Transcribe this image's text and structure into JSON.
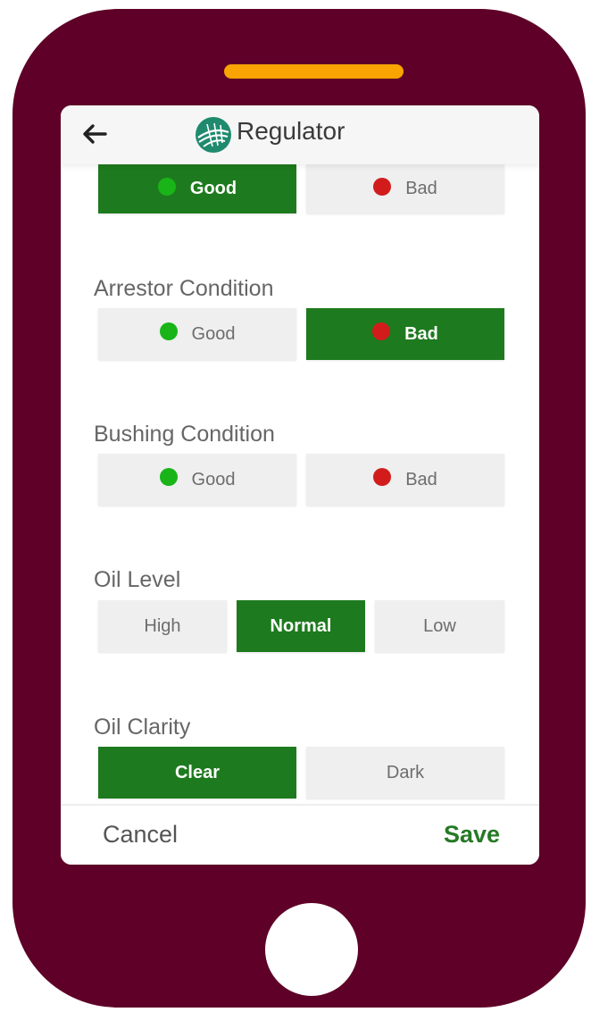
{
  "app": {
    "title": "Regulator"
  },
  "icons": {
    "back": "arrow-left-icon",
    "logo": "cooperative-logo-icon",
    "good_dot": "green-dot-icon",
    "bad_dot": "red-dot-icon"
  },
  "colors": {
    "phone_body": "#5e0027",
    "speaker": "#f9a400",
    "selected": "#1e7a1e",
    "unselected": "#efefef",
    "good": "#18b418",
    "bad": "#d21c1c",
    "save": "#267a26"
  },
  "fields": {
    "top_condition": {
      "options": [
        {
          "label": "Good",
          "selected": true
        },
        {
          "label": "Bad",
          "selected": false
        }
      ]
    },
    "arrestor_condition": {
      "label": "Arrestor Condition",
      "options": [
        {
          "label": "Good",
          "selected": false
        },
        {
          "label": "Bad",
          "selected": true
        }
      ]
    },
    "bushing_condition": {
      "label": "Bushing Condition",
      "options": [
        {
          "label": "Good",
          "selected": false
        },
        {
          "label": "Bad",
          "selected": false
        }
      ]
    },
    "oil_level": {
      "label": "Oil Level",
      "options": [
        {
          "label": "High",
          "selected": false
        },
        {
          "label": "Normal",
          "selected": true
        },
        {
          "label": "Low",
          "selected": false
        }
      ]
    },
    "oil_clarity": {
      "label": "Oil Clarity",
      "options": [
        {
          "label": "Clear",
          "selected": true
        },
        {
          "label": "Dark",
          "selected": false
        }
      ]
    }
  },
  "footer": {
    "cancel_label": "Cancel",
    "save_label": "Save"
  }
}
